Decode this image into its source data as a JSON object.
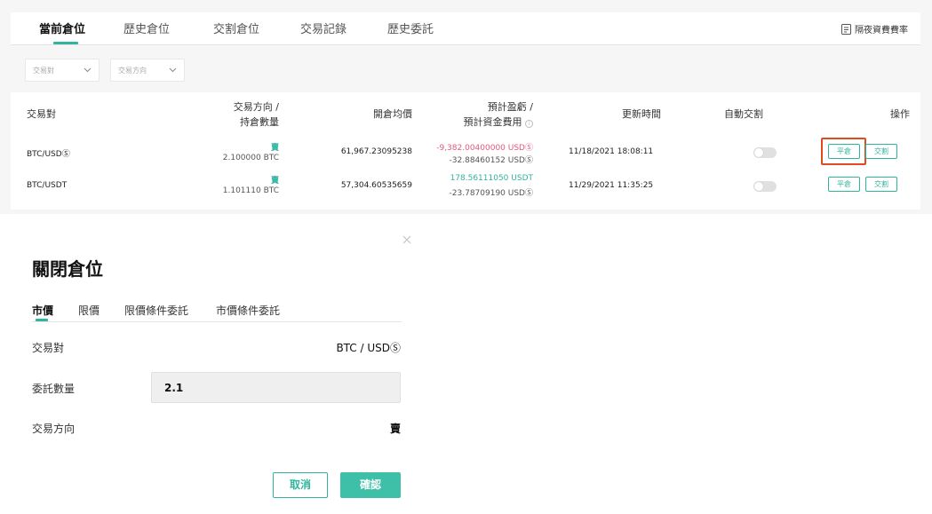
{
  "tabs": [
    {
      "label": "當前倉位",
      "active": true
    },
    {
      "label": "歷史倉位"
    },
    {
      "label": "交割倉位"
    },
    {
      "label": "交易記錄"
    },
    {
      "label": "歷史委託"
    }
  ],
  "fee_link": {
    "label": "隔夜資費費率",
    "icon": "document-list-icon"
  },
  "filters": {
    "pair": {
      "label": "交易對",
      "icon": "chevron-down-icon"
    },
    "direction": {
      "label": "交易方向",
      "icon": "chevron-down-icon"
    }
  },
  "table": {
    "headers": {
      "pair": "交易對",
      "direction_l1": "交易方向 /",
      "direction_l2": "持倉數量",
      "avg_price": "開倉均價",
      "pnl_l1": "預計盈虧 /",
      "pnl_l2": "預計資金費用",
      "updated": "更新時間",
      "auto_delivery": "自動交割",
      "actions": "操作"
    },
    "rows": [
      {
        "pair": "BTC/USDⓈ",
        "direction": "賣",
        "quantity": "2.100000 BTC",
        "avg_price": "61,967.23095238",
        "pnl": "-9,382.00400000 USDⓈ",
        "pnl_status": "negative",
        "funding": "-32.88460152 USDⓈ",
        "updated": "11/18/2021 18:08:11",
        "auto_delivery": false,
        "close_label": "平倉",
        "deliver_label": "交割",
        "close_highlighted": true
      },
      {
        "pair": "BTC/USDT",
        "direction": "賣",
        "quantity": "1.101110 BTC",
        "avg_price": "57,304.60535659",
        "pnl": "178.56111050 USDT",
        "pnl_status": "positive",
        "funding": "-23.78709190 USDⓈ",
        "updated": "11/29/2021 11:35:25",
        "auto_delivery": false,
        "close_label": "平倉",
        "deliver_label": "交割",
        "close_highlighted": false
      }
    ]
  },
  "dialog": {
    "title": "關閉倉位",
    "tabs": [
      {
        "label": "市價",
        "active": true
      },
      {
        "label": "限價"
      },
      {
        "label": "限價條件委託"
      },
      {
        "label": "市價條件委託"
      }
    ],
    "pair_label": "交易對",
    "pair_value": "BTC / USDⓈ",
    "qty_label": "委託數量",
    "qty_value": "2.1",
    "direction_label": "交易方向",
    "direction_value": "賣",
    "cancel_label": "取消",
    "confirm_label": "確認"
  },
  "colors": {
    "accent": "#2fb49d",
    "negative": "#e4577c",
    "highlight": "#e14a1e"
  }
}
